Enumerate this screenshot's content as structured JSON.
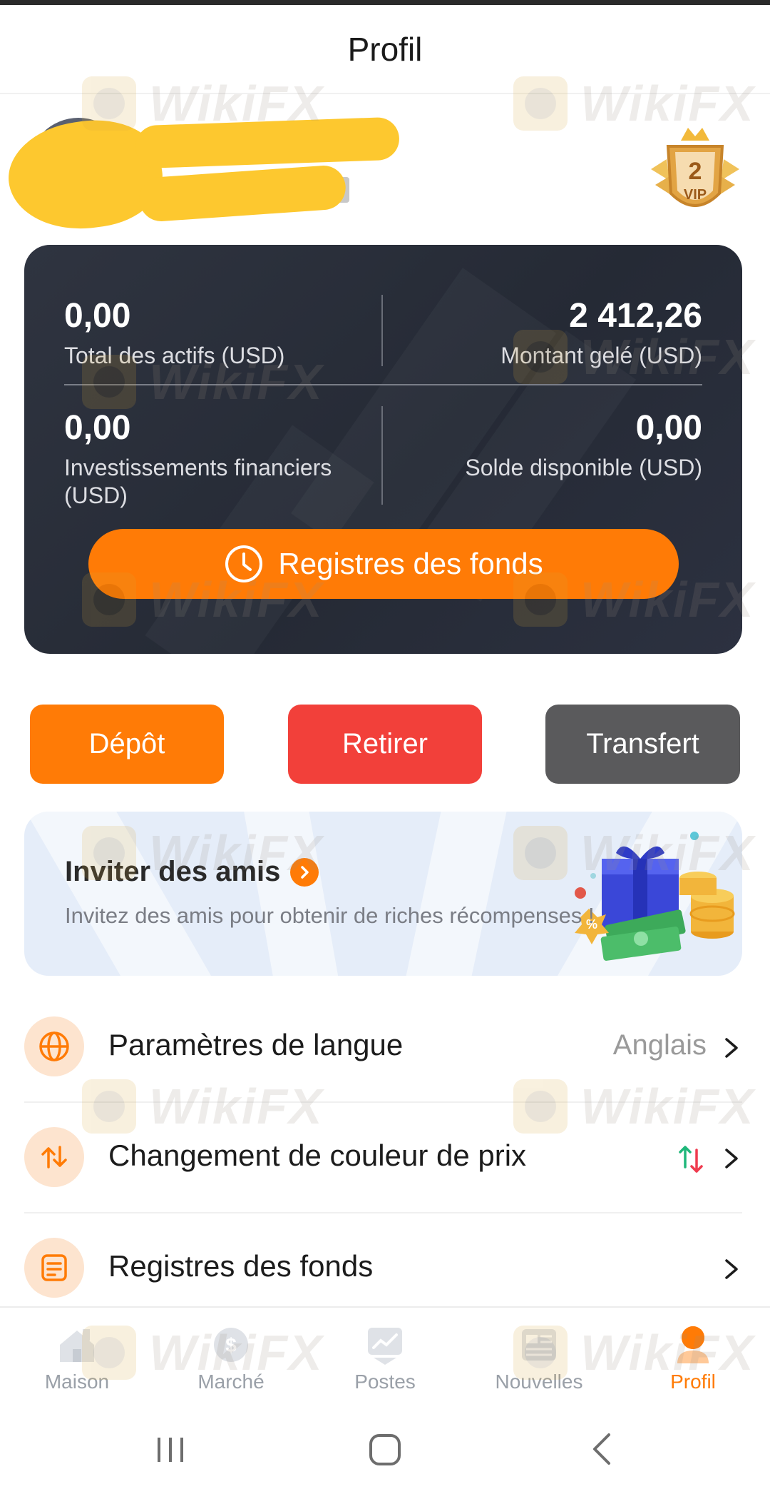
{
  "header": {
    "title": "Profil"
  },
  "profile": {
    "vip_level": "2",
    "vip_label": "VIP"
  },
  "assets": {
    "total_value": "0,00",
    "total_label": "Total des actifs (USD)",
    "frozen_value": "2 412,26",
    "frozen_label": "Montant gelé (USD)",
    "invest_value": "0,00",
    "invest_label": "Investissements financiers (USD)",
    "available_value": "0,00",
    "available_label": "Solde disponible (USD)",
    "records_button": "Registres des fonds"
  },
  "actions": {
    "deposit": "Dépôt",
    "withdraw": "Retirer",
    "transfer": "Transfert"
  },
  "invite": {
    "title": "Inviter des amis",
    "subtitle": "Invitez des amis pour obtenir de riches récompenses !"
  },
  "settings": {
    "language_label": "Paramètres de langue",
    "language_value": "Anglais",
    "price_color_label": "Changement de couleur de prix",
    "fund_records_label": "Registres des fonds"
  },
  "nav": {
    "items": [
      {
        "label": "Maison",
        "icon": "home-icon"
      },
      {
        "label": "Marché",
        "icon": "market-icon"
      },
      {
        "label": "Postes",
        "icon": "positions-icon"
      },
      {
        "label": "Nouvelles",
        "icon": "news-icon"
      },
      {
        "label": "Profil",
        "icon": "profile-icon"
      }
    ],
    "active_index": 4
  },
  "watermark": "WikiFX",
  "colors": {
    "accent": "#ff7b06",
    "withdraw": "#f2403a",
    "transfer": "#5a5a5c",
    "card_bg": "#2b303c"
  }
}
